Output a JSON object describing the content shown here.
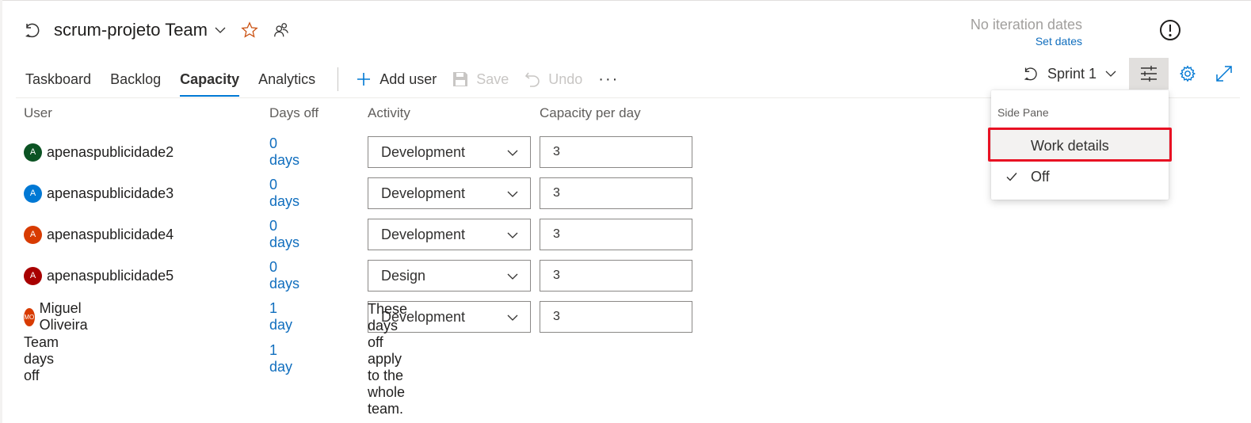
{
  "header": {
    "team_title": "scrum-projeto Team",
    "iteration_status": "No iteration dates",
    "set_dates_link": "Set dates"
  },
  "tabs": [
    {
      "label": "Taskboard",
      "active": false
    },
    {
      "label": "Backlog",
      "active": false
    },
    {
      "label": "Capacity",
      "active": true
    },
    {
      "label": "Analytics",
      "active": false
    }
  ],
  "toolbar": {
    "add_user_label": "Add user",
    "save_label": "Save",
    "undo_label": "Undo",
    "more_label": "···",
    "sprint_label": "Sprint 1"
  },
  "columns": {
    "user": "User",
    "days_off": "Days off",
    "activity": "Activity",
    "capacity": "Capacity per day"
  },
  "rows": [
    {
      "initials": "A",
      "avatar_color": "#0b5323",
      "user": "apenaspublicidade2",
      "days_off": "0 days",
      "activity": "Development",
      "capacity": "3"
    },
    {
      "initials": "A",
      "avatar_color": "#0078d4",
      "user": "apenaspublicidade3",
      "days_off": "0 days",
      "activity": "Development",
      "capacity": "3"
    },
    {
      "initials": "A",
      "avatar_color": "#d83b01",
      "user": "apenaspublicidade4",
      "days_off": "0 days",
      "activity": "Development",
      "capacity": "3"
    },
    {
      "initials": "A",
      "avatar_color": "#a80000",
      "user": "apenaspublicidade5",
      "days_off": "0 days",
      "activity": "Design",
      "capacity": "3"
    },
    {
      "initials": "MO",
      "avatar_color": "#d83b01",
      "user": "Miguel Oliveira",
      "days_off": "1 day",
      "activity": "Development",
      "capacity": "3"
    }
  ],
  "team_days_off": {
    "label": "Team days off",
    "days": "1 day",
    "note": "These days off apply to the whole team."
  },
  "side_pane_menu": {
    "header": "Side Pane",
    "items": [
      {
        "label": "Work details",
        "checked": false,
        "highlighted": true
      },
      {
        "label": "Off",
        "checked": true,
        "highlighted": false
      }
    ]
  },
  "colors": {
    "accent": "#0078d4",
    "link": "#106ebe",
    "star": "#ca5010",
    "highlight_box": "#e81123"
  }
}
